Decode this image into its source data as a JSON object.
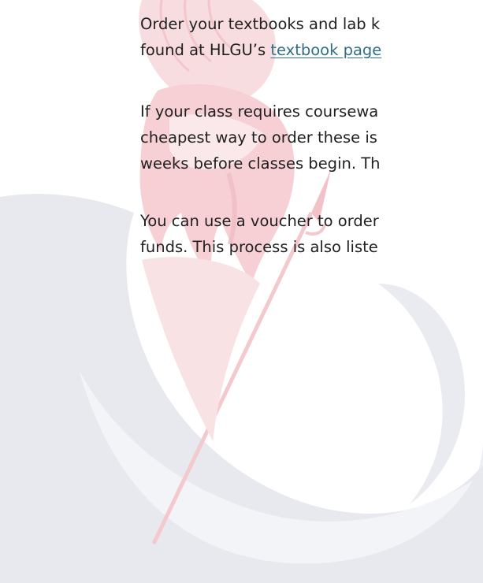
{
  "paragraphs": {
    "p1": {
      "line1": "Order your textbooks and lab k",
      "line2_prefix": "found at HLGU’s ",
      "line2_link": "textbook page"
    },
    "p2": {
      "line1": "If your class requires coursewa",
      "line2": "cheapest way to order these is",
      "line3": "weeks before classes begin. Th"
    },
    "p3": {
      "line1": "You can use a voucher to order",
      "line2": "funds. This process is also liste"
    }
  },
  "colors": {
    "text": "#1f1f1f",
    "link": "#2f6f86",
    "watermark_red": "#f6d4d8",
    "watermark_gray": "#e9ebf1"
  },
  "watermark_icon": "spartan-helmet-logo"
}
